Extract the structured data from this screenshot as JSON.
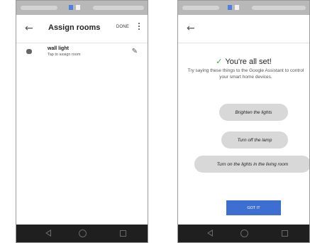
{
  "left_screen": {
    "appbar": {
      "back_icon": "arrow-back-icon",
      "title": "Assign rooms",
      "done_label": "DONE",
      "overflow_icon": "more-vert-icon"
    },
    "device": {
      "icon": "device-icon",
      "name": "wall light",
      "subtitle": "Tap to assign room",
      "edit_icon": "pencil-icon"
    }
  },
  "right_screen": {
    "appbar": {
      "back_icon": "arrow-back-icon"
    },
    "success": {
      "check_icon": "✓",
      "title": "You're all set!",
      "body": "Try saying these things to the Google Assistant to control your smart home devices."
    },
    "suggestions": [
      "Brighten the lights",
      "Turn off the lamp",
      "Turn on the lights in the living room"
    ],
    "got_it_label": "GOT IT"
  },
  "colors": {
    "accent": "#3d6fd2",
    "check": "#31a852",
    "navbar": "#1f1f1f",
    "statusbar": "#b8b8b8",
    "chip": "#d8d8d8"
  }
}
